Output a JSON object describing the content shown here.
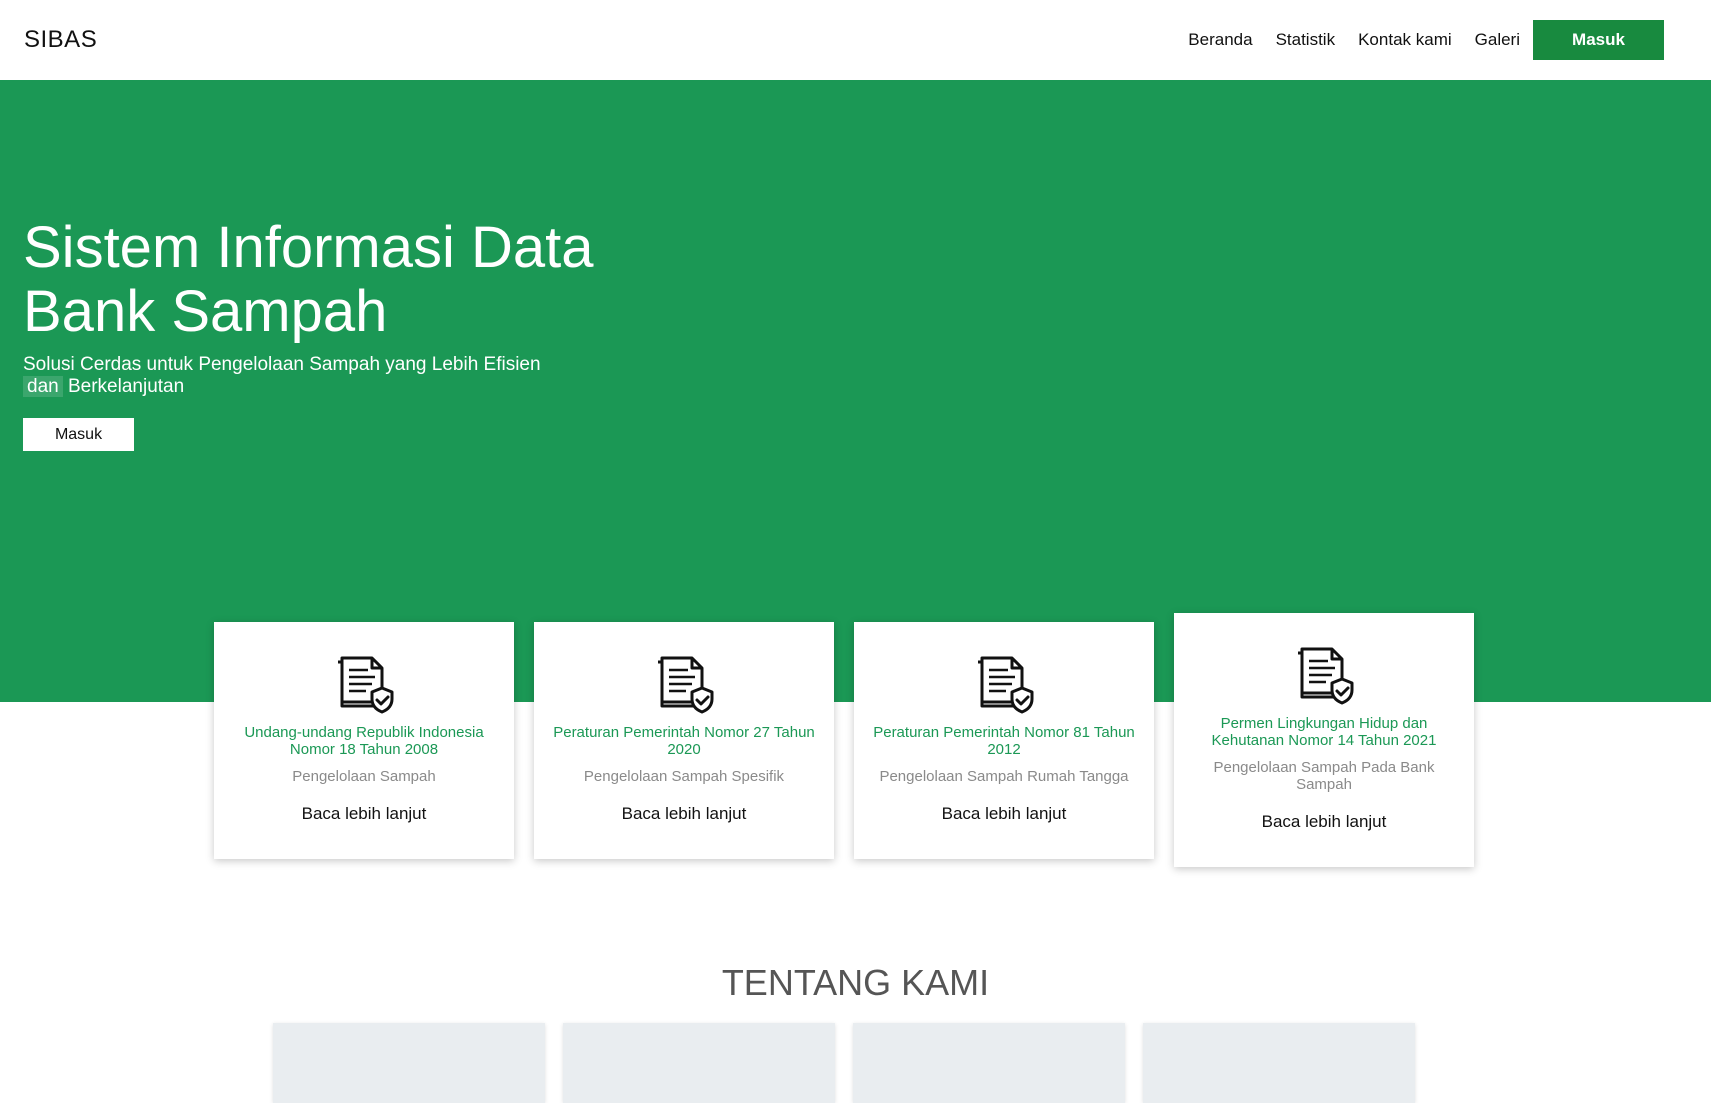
{
  "header": {
    "brand": "SIBAS",
    "nav": [
      "Beranda",
      "Statistik",
      "Kontak kami",
      "Galeri"
    ],
    "login_label": "Masuk"
  },
  "hero": {
    "title": "Sistem Informasi Data Bank Sampah",
    "subtitle_main": "Solusi Cerdas untuk Pengelolaan Sampah yang Lebih Efisien",
    "subtitle_highlight": "dan",
    "subtitle_end": "Berkelanjutan",
    "login_label": "Masuk",
    "background_color": "#1b9855"
  },
  "cards": [
    {
      "icon": "document-shield-icon",
      "title": "Undang-undang Republik Indonesia Nomor 18 Tahun 2008",
      "description": "Pengelolaan Sampah",
      "link": "Baca lebih lanjut"
    },
    {
      "icon": "document-shield-icon",
      "title": "Peraturan Pemerintah Nomor 27 Tahun 2020",
      "description": "Pengelolaan Sampah Spesifik",
      "link": "Baca lebih lanjut"
    },
    {
      "icon": "document-shield-icon",
      "title": "Peraturan Pemerintah Nomor 81 Tahun 2012",
      "description": "Pengelolaan Sampah Rumah Tangga",
      "link": "Baca lebih lanjut"
    },
    {
      "icon": "document-shield-icon",
      "title": "Permen Lingkungan Hidup dan Kehutanan Nomor 14 Tahun 2021",
      "description": "Pengelolaan Sampah Pada Bank Sampah",
      "link": "Baca lebih lanjut"
    }
  ],
  "about": {
    "title": "TENTANG KAMI"
  },
  "colors": {
    "brand_green": "#188a3f",
    "card_title_green": "#1b9855"
  }
}
